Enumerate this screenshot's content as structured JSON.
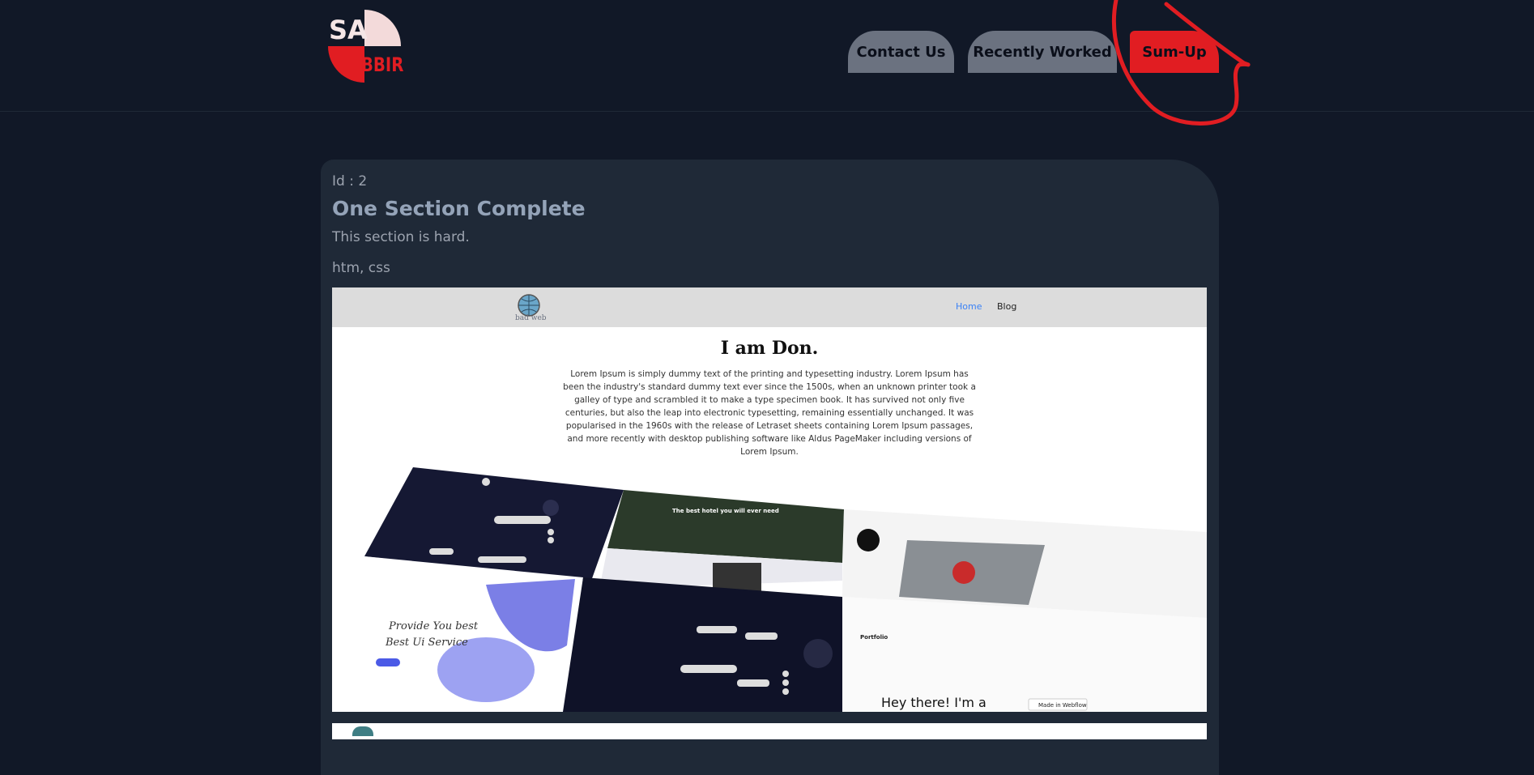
{
  "header": {
    "logo": {
      "top": "SA",
      "bottom": "BBIR"
    },
    "nav": [
      {
        "label": "Contact Us"
      },
      {
        "label": "Recently Worked"
      },
      {
        "label": "Sum-Up"
      }
    ]
  },
  "card": {
    "id_line": "Id : 2",
    "title": "One Section Complete",
    "description": "This section is hard.",
    "tech": "htm, css",
    "preview": {
      "logo_text": "bad web",
      "nav_home": "Home",
      "nav_blog": "Blog",
      "heading": "I am Don.",
      "paragraph": "Lorem Ipsum is simply dummy text of the printing and typesetting industry. Lorem Ipsum has been the industry's standard dummy text ever since the 1500s, when an unknown printer took a galley of type and scrambled it to make a type specimen book. It has survived not only five centuries, but also the leap into electronic typesetting, remaining essentially unchanged. It was popularised in the 1960s with the release of Letraset sheets containing Lorem Ipsum passages, and more recently with desktop publishing software like Aldus PageMaker including versions of Lorem Ipsum.",
      "mock_text_1": "Provide You best",
      "mock_text_2": "Best Ui Service",
      "mock_text_3": "Hey there! I'm a",
      "mock_text_4": "Made in Webflow",
      "mock_text_5": "The best hotel you will ever need",
      "mock_text_6": "Portfolio"
    }
  },
  "colors": {
    "page_bg": "#111827",
    "card_bg": "#1f2937",
    "nav_gray": "#6b7280",
    "accent_red": "#e11d22"
  }
}
